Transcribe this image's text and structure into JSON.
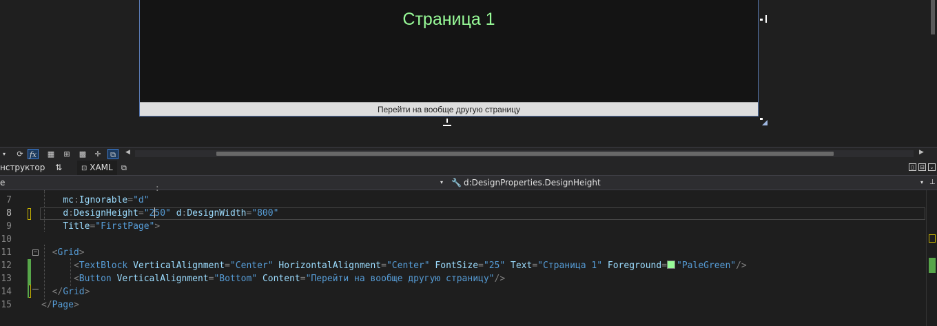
{
  "designer": {
    "page_text": "Страница 1",
    "page_text_color": "#98fb98",
    "button_text": "Перейти на вообще другую страницу"
  },
  "toolbar": {
    "icons": [
      "dropdown-arrow-icon",
      "refresh-icon",
      "fx-icon",
      "grid-icon",
      "snap-grid-icon",
      "checker-icon",
      "snap-point-icon",
      "artboard-icon"
    ]
  },
  "tabs": {
    "designer_label": "нструктор",
    "swap_glyph": "⇅",
    "xaml_label": "XAML"
  },
  "navbar": {
    "left_label": "е",
    "member_label": "d:DesignProperties.DesignHeight"
  },
  "editor": {
    "line_numbers": [
      "7",
      "8",
      "9",
      "10",
      "11",
      "12",
      "13",
      "14",
      "15"
    ],
    "current_line": "8"
  }
}
